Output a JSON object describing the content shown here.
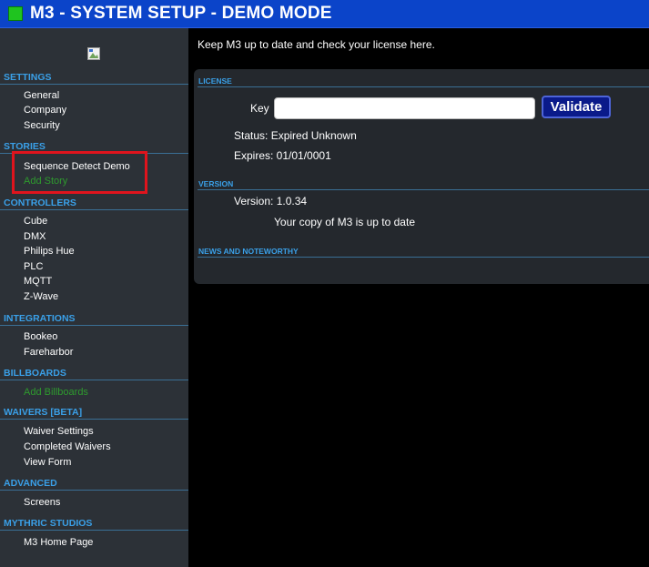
{
  "header": {
    "title": "M3 - SYSTEM SETUP - DEMO MODE",
    "logo_color": "#1fc41f"
  },
  "sidebar": {
    "sections": [
      {
        "title": "SETTINGS",
        "items": [
          "General",
          "Company",
          "Security"
        ]
      },
      {
        "title": "STORIES",
        "items": [
          "Sequence Detect Demo",
          "Add Story"
        ]
      },
      {
        "title": "CONTROLLERS",
        "items": [
          "Cube",
          "DMX",
          "Philips Hue",
          "PLC",
          "MQTT",
          "Z-Wave"
        ]
      },
      {
        "title": "INTEGRATIONS",
        "items": [
          "Bookeo",
          "Fareharbor"
        ]
      },
      {
        "title": "BILLBOARDS",
        "items": [
          "Add Billboards"
        ]
      },
      {
        "title": "WAIVERS [BETA]",
        "items": [
          "Waiver Settings",
          "Completed Waivers",
          "View Form"
        ]
      },
      {
        "title": "ADVANCED",
        "items": [
          "Screens"
        ]
      },
      {
        "title": "MYTHRIC STUDIOS",
        "items": [
          "M3 Home Page"
        ]
      }
    ]
  },
  "main": {
    "intro": "Keep M3 up to date and check your license here.",
    "license": {
      "section_title": "LICENSE",
      "key_label": "Key",
      "key_value": "",
      "validate_label": "Validate",
      "status_text": "Status: Expired Unknown",
      "expires_text": "Expires: 01/01/0001"
    },
    "version": {
      "section_title": "VERSION",
      "version_text": "Version: 1.0.34",
      "update_text": "Your copy of M3 is up to date"
    },
    "news": {
      "section_title": "NEWS AND NOTEWORTHY"
    }
  },
  "colors": {
    "header_bg": "#0b44c9",
    "section_header": "#3aa0e8",
    "add_link": "#2e9b2e",
    "highlight": "#e0141d",
    "validate_bg": "#0a1a8a"
  }
}
